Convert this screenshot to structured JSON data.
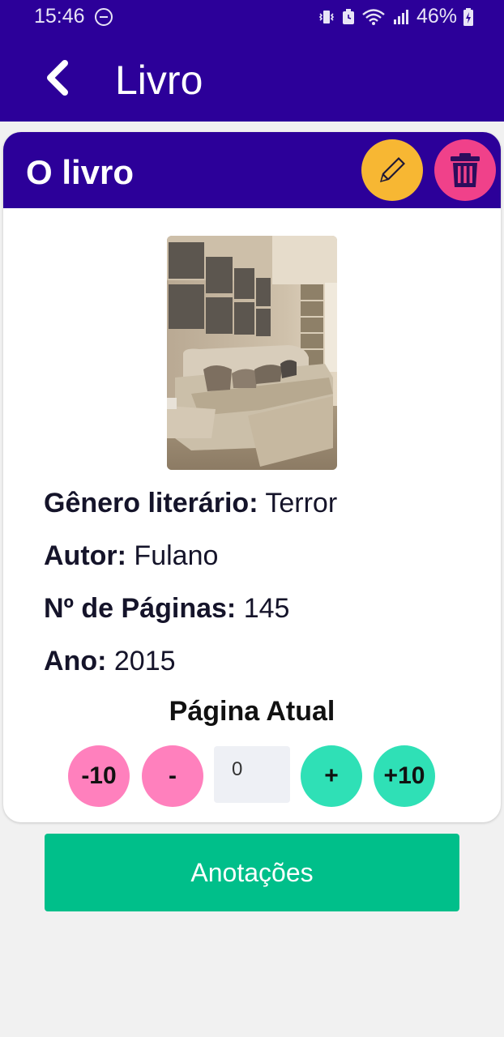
{
  "status_bar": {
    "time": "15:46",
    "battery": "46%",
    "icons": [
      "do-not-disturb-icon",
      "vibrate-icon",
      "alarm-icon",
      "wifi-icon",
      "signal-icon",
      "battery-icon"
    ]
  },
  "app_bar": {
    "title": "Livro",
    "back_icon": "chevron-left-icon"
  },
  "card": {
    "title": "O livro",
    "edit_icon": "pencil-icon",
    "delete_icon": "trash-icon",
    "edit_color": "#f7b733",
    "delete_color": "#f0418a",
    "header_color": "#2c0099"
  },
  "book": {
    "genre_label": "Gênero literário:",
    "genre_value": "Terror",
    "author_label": "Autor:",
    "author_value": "Fulano",
    "pages_label": "Nº de Páginas:",
    "pages_value": "145",
    "year_label": "Ano:",
    "year_value": "2015"
  },
  "current_page": {
    "label": "Página Atual",
    "minus_ten": "-10",
    "minus_one": "-",
    "value": "0",
    "plus_one": "+",
    "plus_ten": "+10"
  },
  "notes_button": {
    "label": "Anotações",
    "color": "#00bf8a"
  }
}
